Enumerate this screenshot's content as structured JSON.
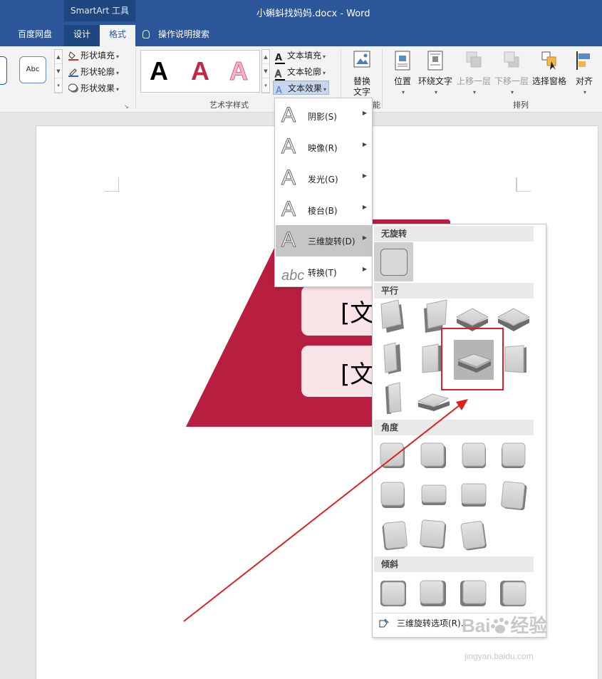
{
  "window": {
    "context_header": "SmartArt 工具",
    "doc_title": "小蝌蚪找妈妈.docx - Word"
  },
  "tabs": [
    {
      "label": "百度网盘"
    },
    {
      "label": "设计"
    },
    {
      "label": "格式"
    }
  ],
  "tell_me": "操作说明搜索",
  "ribbon": {
    "shape_abc": "Abc",
    "shape_fill": "形状填充",
    "shape_outline": "形状轮廓",
    "shape_effects": "形状效果",
    "wordart_label": "艺术字样式",
    "wordart_glyph": "A",
    "text_fill": "文本填充",
    "text_outline": "文本轮廓",
    "text_effects": "文本效果",
    "alt_text": "替换\n文字",
    "alt_text_l1": "替换",
    "alt_text_l2": "文字",
    "position": "位置",
    "wrap_text": "环绕文字",
    "bring_forward": "上移一层",
    "send_backward": "下移一层",
    "selection_pane": "选择窗格",
    "align": "对齐",
    "arrange_label": "排列",
    "partial_label_3": "能"
  },
  "document": {
    "smartart_text_1": "[文",
    "smartart_text_2": "[文"
  },
  "text_effects_menu": [
    {
      "label": "阴影(S)",
      "glyph": "A"
    },
    {
      "label": "映像(R)",
      "glyph": "A"
    },
    {
      "label": "发光(G)",
      "glyph": "A"
    },
    {
      "label": "棱台(B)",
      "glyph": "A"
    },
    {
      "label": "三维旋转(D)",
      "glyph": "A"
    },
    {
      "label": "转换(T)",
      "glyph": "abc"
    }
  ],
  "rotation_submenu": {
    "sections": [
      {
        "title": "无旋转"
      },
      {
        "title": "平行"
      },
      {
        "title": "角度"
      },
      {
        "title": "倾斜"
      }
    ],
    "footer": "三维旋转选项(R)..."
  },
  "watermark": {
    "brand": "Bai",
    "brand2": "经验",
    "url": "jingyan.baidu.com"
  },
  "colors": {
    "accent_blue": "#2b579a",
    "smartart_red": "#b81e3f",
    "highlight_red": "#e02020"
  }
}
